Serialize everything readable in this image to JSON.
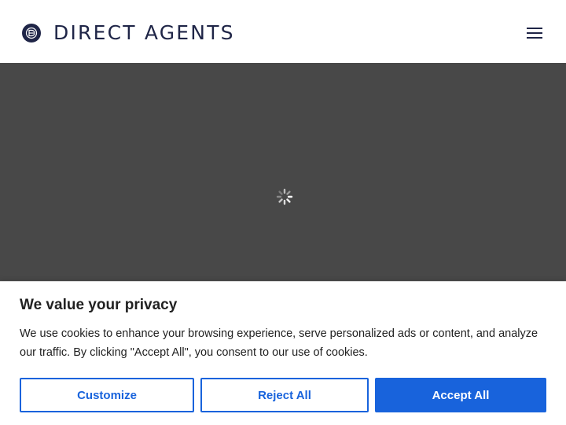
{
  "header": {
    "logo_text": "DIRECT AGENTS",
    "logo_icon": "direct-agents-logo-icon",
    "menu_icon": "hamburger-menu-icon"
  },
  "hero": {
    "loading_icon": "spinner-icon"
  },
  "cookie_banner": {
    "title": "We value your privacy",
    "description": "We use cookies to enhance your browsing experience, serve personalized ads or content, and analyze our traffic. By clicking \"Accept All\", you consent to our use of cookies.",
    "buttons": {
      "customize": "Customize",
      "reject": "Reject All",
      "accept": "Accept All"
    }
  },
  "colors": {
    "brand_navy": "#1f2547",
    "accent_blue": "#1863dc",
    "hero_background": "#484848"
  }
}
